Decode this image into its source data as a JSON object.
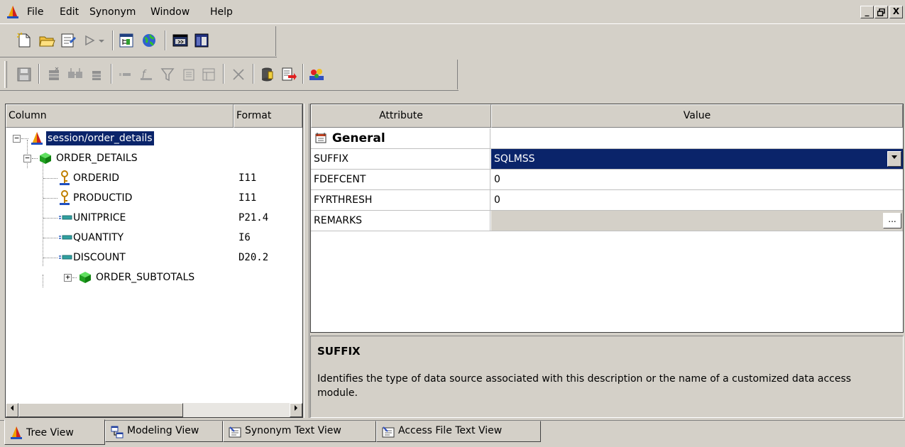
{
  "menubar": {
    "items": [
      "File",
      "Edit",
      "Synonym",
      "Window",
      "Help"
    ],
    "window_controls": [
      "_",
      "Ő",
      "X"
    ]
  },
  "toolbar1": {
    "icons": [
      "new-icon",
      "open-folder-icon",
      "properties-icon",
      "run-icon",
      "dropdown-arrow-icon",
      "tree-panel-icon",
      "globe-icon",
      "console-icon",
      "window-icon"
    ]
  },
  "toolbar2": {
    "icons": [
      "save-icon",
      "segment-icon",
      "join-icon",
      "delete-segment-icon",
      "field-icon",
      "computed-field-icon",
      "filter-icon",
      "define-icon",
      "group-icon",
      "delete-icon",
      "database-icon",
      "export-icon",
      "analyze-icon"
    ]
  },
  "tree": {
    "headers": {
      "column": "Column",
      "format": "Format"
    },
    "root": "session/order_details",
    "segment": "ORDER_DETAILS",
    "fields": [
      {
        "name": "ORDERID",
        "format": "I11",
        "type": "key"
      },
      {
        "name": "PRODUCTID",
        "format": "I11",
        "type": "key"
      },
      {
        "name": "UNITPRICE",
        "format": "P21.4",
        "type": "field"
      },
      {
        "name": "QUANTITY",
        "format": "I6",
        "type": "field"
      },
      {
        "name": "DISCOUNT",
        "format": "D20.2",
        "type": "field"
      }
    ],
    "subsegment": "ORDER_SUBTOTALS",
    "expander_open": "−",
    "expander_closed": "+"
  },
  "properties": {
    "headers": {
      "attribute": "Attribute",
      "value": "Value"
    },
    "group": "General",
    "rows": [
      {
        "attribute": "SUFFIX",
        "value": "SQLMSS"
      },
      {
        "attribute": "FDEFCENT",
        "value": "0"
      },
      {
        "attribute": "FYRTHRESH",
        "value": "0"
      },
      {
        "attribute": "REMARKS",
        "value": ""
      }
    ],
    "ellipsis": "..."
  },
  "description": {
    "title": "SUFFIX",
    "text": "Identifies the type of data source associated with this description or the name of a customized data access module."
  },
  "tabs": [
    {
      "label": "Tree View",
      "icon": "tree-view-icon",
      "active": true
    },
    {
      "label": "Modeling View",
      "icon": "modeling-view-icon",
      "active": false
    },
    {
      "label": "Synonym Text View",
      "icon": "text-view-icon",
      "active": false
    },
    {
      "label": "Access File Text View",
      "icon": "text-view-icon",
      "active": false
    }
  ],
  "colors": {
    "selection": "#0a246a",
    "chrome": "#d4d0c8",
    "segment_green": "#2db82d"
  }
}
